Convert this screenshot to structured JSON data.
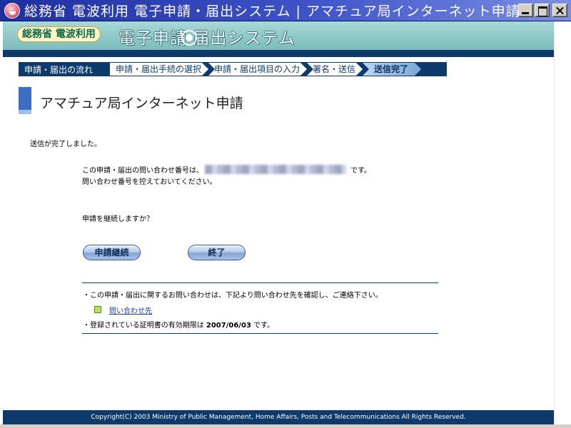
{
  "window": {
    "title": "総務省 電波利用 電子申請・届出システム | アマチュア局インターネット申請"
  },
  "header": {
    "logo_text": "総務省 電波利用",
    "system_title": "電子申請 届出システム"
  },
  "steps": {
    "flow_label": "申請・届出の流れ",
    "items": [
      {
        "label": "申請・届出手続の選択"
      },
      {
        "label": "申請・届出項目の入力"
      },
      {
        "label": "署名・送信"
      },
      {
        "label": "送信完了"
      }
    ],
    "current_index": 3
  },
  "page": {
    "title": "アマチュア局インターネット申請",
    "complete_message": "送信が完了しました。",
    "inquiry_prefix": "この申請・届出の問い合わせ番号は、",
    "inquiry_suffix": "です。",
    "keep_message": "問い合わせ番号を控えておいてください。",
    "continue_question": "申請を継続しますか？",
    "buttons": {
      "continue_label": "申請継続",
      "end_label": "終了"
    },
    "notes": {
      "contact_note": "・この申請・届出に関するお問い合わせは、下記より問い合わせ先を確認し、ご連絡下さい。",
      "contact_link": "問い合わせ先",
      "cert_prefix": "・登録されている証明書の有効期限は",
      "cert_date": "2007/06/03",
      "cert_suffix": "です。"
    }
  },
  "footer": {
    "copyright": "Copyright(C) 2003 Ministry of Public Management, Home Affairs, Posts and Telecommunications All Rights Reserved."
  },
  "colors": {
    "navy": "#0d3a6b",
    "header_teal": "#8cc7c6",
    "title_bar": "#1e2fa0",
    "accent_blue": "#3b6ec2"
  },
  "icons": {
    "app": "app-icon",
    "minimize": "minimize-icon",
    "maximize": "maximize-icon",
    "close": "close-icon",
    "wave": "wave-icon",
    "bullet": "green-square-icon"
  }
}
